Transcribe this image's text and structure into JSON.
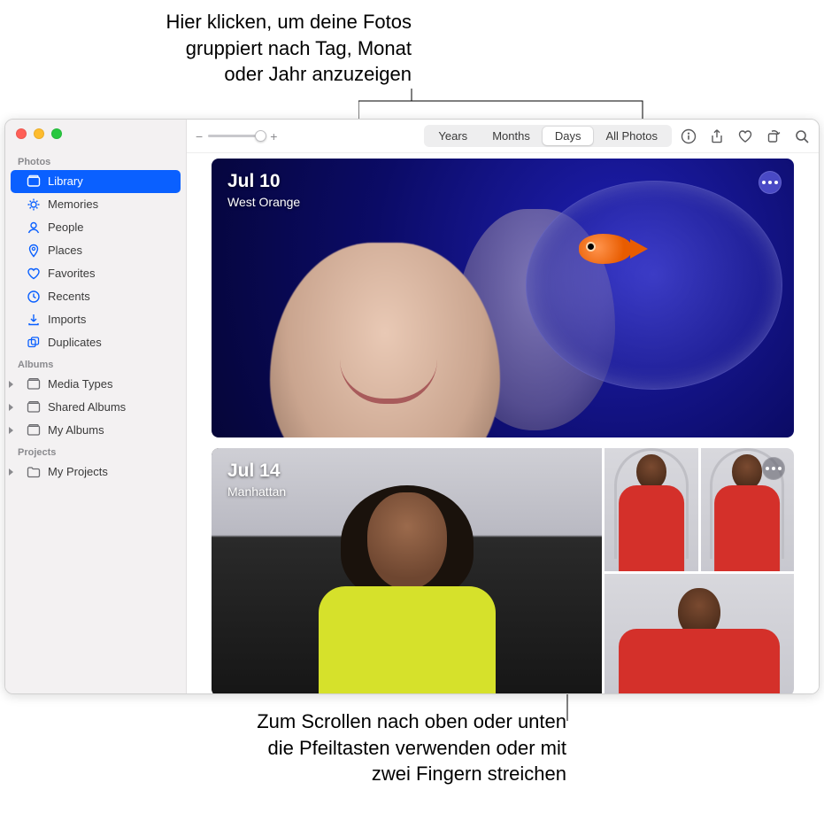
{
  "annotations": {
    "top": "Hier klicken, um deine Fotos\ngruppiert nach Tag, Monat\noder Jahr anzuzeigen",
    "bottom": "Zum Scrollen nach oben oder unten\ndie Pfeiltasten verwenden oder mit\nzwei Fingern streichen"
  },
  "sidebar": {
    "sections": {
      "photos_header": "Photos",
      "albums_header": "Albums",
      "projects_header": "Projects"
    },
    "items": {
      "library": "Library",
      "memories": "Memories",
      "people": "People",
      "places": "Places",
      "favorites": "Favorites",
      "recents": "Recents",
      "imports": "Imports",
      "duplicates": "Duplicates",
      "media_types": "Media Types",
      "shared_albums": "Shared Albums",
      "my_albums": "My Albums",
      "my_projects": "My Projects"
    }
  },
  "toolbar": {
    "zoom": {
      "minus": "−",
      "plus": "+"
    },
    "segments": {
      "years": "Years",
      "months": "Months",
      "days": "Days",
      "all": "All Photos"
    }
  },
  "content": {
    "day1": {
      "date": "Jul 10",
      "location": "West Orange"
    },
    "day2": {
      "date": "Jul 14",
      "location": "Manhattan"
    }
  }
}
